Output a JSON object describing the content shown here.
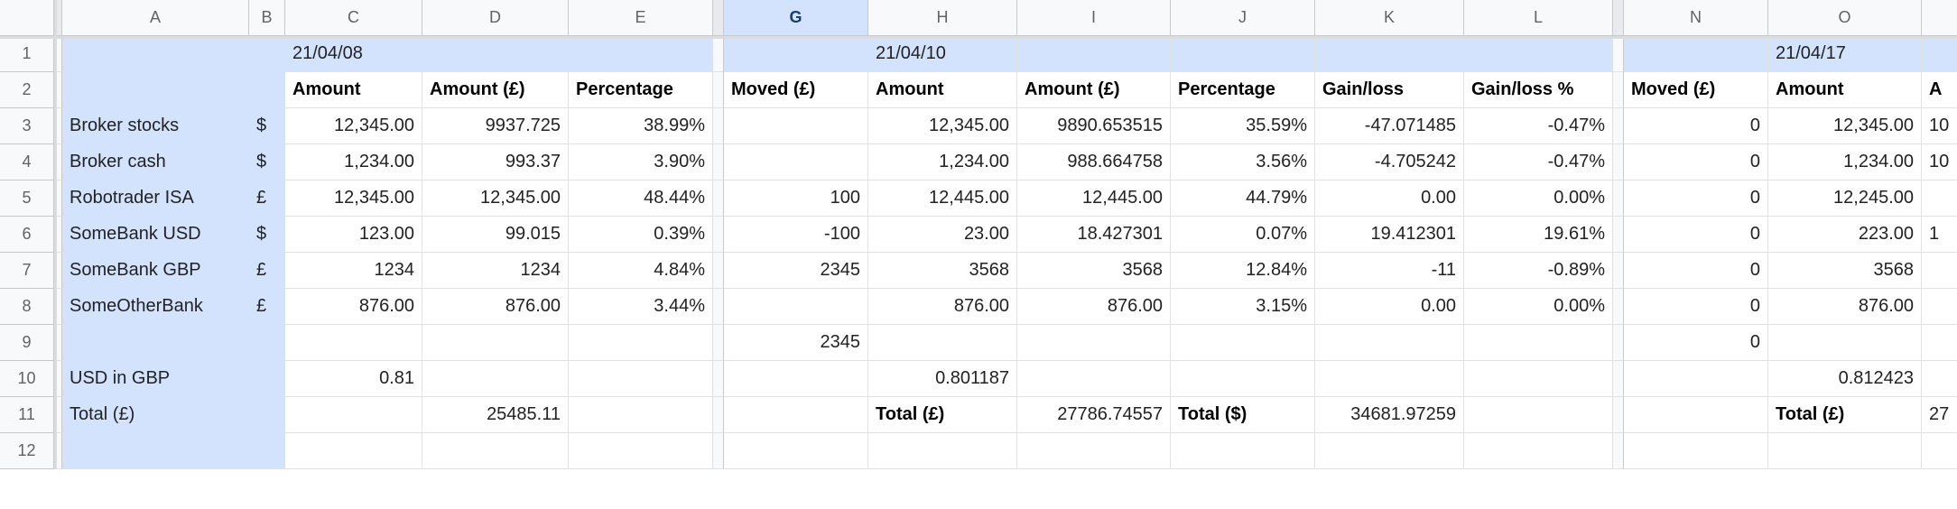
{
  "columns": {
    "A": "A",
    "B": "B",
    "C": "C",
    "D": "D",
    "E": "E",
    "G": "G",
    "H": "H",
    "I": "I",
    "J": "J",
    "K": "K",
    "L": "L",
    "N": "N",
    "O": "O",
    "P": "A"
  },
  "row_labels": [
    "1",
    "2",
    "3",
    "4",
    "5",
    "6",
    "7",
    "8",
    "9",
    "10",
    "11",
    "12"
  ],
  "r1": {
    "C": "21/04/08",
    "H": "21/04/10",
    "O": "21/04/17"
  },
  "r2": {
    "C": "Amount",
    "D": "Amount (£)",
    "E": "Percentage",
    "G": "Moved (£)",
    "H": "Amount",
    "I": "Amount (£)",
    "J": "Percentage",
    "K": "Gain/loss",
    "L": "Gain/loss %",
    "N": "Moved (£)",
    "O": "Amount",
    "P": "A"
  },
  "labels": {
    "r3": "Broker stocks",
    "r4": "Broker cash",
    "r5": "Robotrader ISA",
    "r6": "SomeBank USD",
    "r7": "SomeBank GBP",
    "r8": "SomeOtherBank",
    "r10": "USD in GBP",
    "r11": "Total (£)"
  },
  "cur": {
    "r3": "$",
    "r4": "$",
    "r5": "£",
    "r6": "$",
    "r7": "£",
    "r8": "£"
  },
  "grid": {
    "r3": {
      "C": "12,345.00",
      "D": "9937.725",
      "E": "38.99%",
      "H": "12,345.00",
      "I": "9890.653515",
      "J": "35.59%",
      "K": "-47.071485",
      "L": "-0.47%",
      "N": "0",
      "O": "12,345.00",
      "P": "10"
    },
    "r4": {
      "C": "1,234.00",
      "D": "993.37",
      "E": "3.90%",
      "H": "1,234.00",
      "I": "988.664758",
      "J": "3.56%",
      "K": "-4.705242",
      "L": "-0.47%",
      "N": "0",
      "O": "1,234.00",
      "P": "10"
    },
    "r5": {
      "C": "12,345.00",
      "D": "12,345.00",
      "E": "48.44%",
      "G": "100",
      "H": "12,445.00",
      "I": "12,445.00",
      "J": "44.79%",
      "K": "0.00",
      "L": "0.00%",
      "N": "0",
      "O": "12,245.00"
    },
    "r6": {
      "C": "123.00",
      "D": "99.015",
      "E": "0.39%",
      "G": "-100",
      "H": "23.00",
      "I": "18.427301",
      "J": "0.07%",
      "K": "19.412301",
      "L": "19.61%",
      "N": "0",
      "O": "223.00",
      "P": "1"
    },
    "r7": {
      "C": "1234",
      "D": "1234",
      "E": "4.84%",
      "G": "2345",
      "H": "3568",
      "I": "3568",
      "J": "12.84%",
      "K": "-11",
      "L": "-0.89%",
      "N": "0",
      "O": "3568"
    },
    "r8": {
      "C": "876.00",
      "D": "876.00",
      "E": "3.44%",
      "H": "876.00",
      "I": "876.00",
      "J": "3.15%",
      "K": "0.00",
      "L": "0.00%",
      "N": "0",
      "O": "876.00"
    },
    "r9": {
      "G": "2345",
      "N": "0"
    },
    "r10": {
      "C": "0.81",
      "H": "0.801187",
      "O": "0.812423"
    },
    "r11": {
      "D": "25485.11",
      "H": "Total (£)",
      "I": "27786.74557",
      "J": "Total ($)",
      "K": "34681.97259",
      "O": "Total (£)",
      "P": "27"
    }
  },
  "selected_col": "G",
  "chart_data": {
    "type": "table",
    "dates": [
      "21/04/08",
      "21/04/10",
      "21/04/17"
    ],
    "rows": [
      {
        "name": "Broker stocks",
        "currency": "$",
        "blocks": [
          {
            "Amount": "12,345.00",
            "Amount (£)": "9937.725",
            "Percentage": "38.99%"
          },
          {
            "Moved (£)": "",
            "Amount": "12,345.00",
            "Amount (£)": "9890.653515",
            "Percentage": "35.59%",
            "Gain/loss": "-47.071485",
            "Gain/loss %": "-0.47%"
          },
          {
            "Moved (£)": "0",
            "Amount": "12,345.00"
          }
        ]
      },
      {
        "name": "Broker cash",
        "currency": "$",
        "blocks": [
          {
            "Amount": "1,234.00",
            "Amount (£)": "993.37",
            "Percentage": "3.90%"
          },
          {
            "Moved (£)": "",
            "Amount": "1,234.00",
            "Amount (£)": "988.664758",
            "Percentage": "3.56%",
            "Gain/loss": "-4.705242",
            "Gain/loss %": "-0.47%"
          },
          {
            "Moved (£)": "0",
            "Amount": "1,234.00"
          }
        ]
      },
      {
        "name": "Robotrader ISA",
        "currency": "£",
        "blocks": [
          {
            "Amount": "12,345.00",
            "Amount (£)": "12,345.00",
            "Percentage": "48.44%"
          },
          {
            "Moved (£)": "100",
            "Amount": "12,445.00",
            "Amount (£)": "12,445.00",
            "Percentage": "44.79%",
            "Gain/loss": "0.00",
            "Gain/loss %": "0.00%"
          },
          {
            "Moved (£)": "0",
            "Amount": "12,245.00"
          }
        ]
      },
      {
        "name": "SomeBank USD",
        "currency": "$",
        "blocks": [
          {
            "Amount": "123.00",
            "Amount (£)": "99.015",
            "Percentage": "0.39%"
          },
          {
            "Moved (£)": "-100",
            "Amount": "23.00",
            "Amount (£)": "18.427301",
            "Percentage": "0.07%",
            "Gain/loss": "19.412301",
            "Gain/loss %": "19.61%"
          },
          {
            "Moved (£)": "0",
            "Amount": "223.00"
          }
        ]
      },
      {
        "name": "SomeBank GBP",
        "currency": "£",
        "blocks": [
          {
            "Amount": "1234",
            "Amount (£)": "1234",
            "Percentage": "4.84%"
          },
          {
            "Moved (£)": "2345",
            "Amount": "3568",
            "Amount (£)": "3568",
            "Percentage": "12.84%",
            "Gain/loss": "-11",
            "Gain/loss %": "-0.89%"
          },
          {
            "Moved (£)": "0",
            "Amount": "3568"
          }
        ]
      },
      {
        "name": "SomeOtherBank",
        "currency": "£",
        "blocks": [
          {
            "Amount": "876.00",
            "Amount (£)": "876.00",
            "Percentage": "3.44%"
          },
          {
            "Moved (£)": "",
            "Amount": "876.00",
            "Amount (£)": "876.00",
            "Percentage": "3.15%",
            "Gain/loss": "0.00",
            "Gain/loss %": "0.00%"
          },
          {
            "Moved (£)": "0",
            "Amount": "876.00"
          }
        ]
      }
    ],
    "moved_total_row9": {
      "G": "2345",
      "N": "0"
    },
    "usd_in_gbp": {
      "21/04/08": "0.81",
      "21/04/10": "0.801187",
      "21/04/17": "0.812423"
    },
    "totals": {
      "21/04/08 £": "25485.11",
      "21/04/10 £": "27786.74557",
      "21/04/10 $": "34681.97259"
    }
  }
}
